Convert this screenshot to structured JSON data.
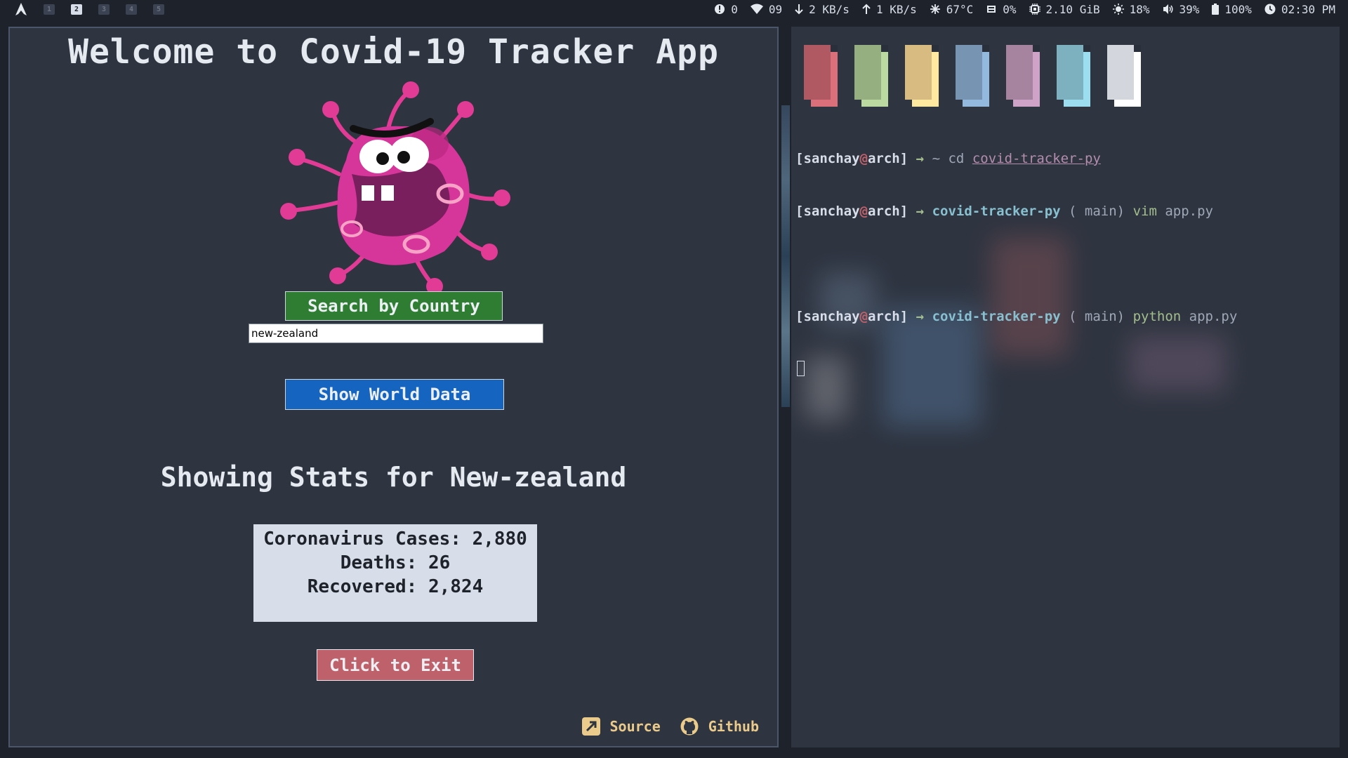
{
  "topbar": {
    "workspaces": [
      "1",
      "2",
      "3",
      "4",
      "5"
    ],
    "active_workspace": "2",
    "status": {
      "updates": "0",
      "wifi": "09",
      "download": "2 KB/s",
      "upload": "1 KB/s",
      "temperature": "67°C",
      "cpu": "0%",
      "memory": "2.10 GiB",
      "brightness": "18%",
      "volume": "39%",
      "battery": "100%",
      "clock": "02:30 PM"
    }
  },
  "app": {
    "title": "Welcome to Covid-19 Tracker App",
    "search_button_label": "Search by Country",
    "search_value": "new-zealand",
    "world_button_label": "Show World Data",
    "showing_heading": "Showing Stats for New-zealand",
    "stats": {
      "cases": "Coronavirus Cases: 2,880",
      "deaths": "Deaths: 26",
      "recovered": "Recovered: 2,824"
    },
    "exit_button_label": "Click to Exit",
    "links": {
      "source": "Source",
      "github": "Github"
    }
  },
  "terminal": {
    "swatch_colors": [
      "#bf616a",
      "#a3be8c",
      "#ebcb8b",
      "#81a1c1",
      "#b48ead",
      "#88c0d0",
      "#e5e9f0"
    ],
    "lines": [
      {
        "bracket_open": "[",
        "user": "sanchay",
        "at": "@",
        "host": "arch",
        "bracket_close": "]",
        "arrow": "→",
        "dir": "~",
        "cmd": "cd",
        "arg": "covid-tracker-py"
      },
      {
        "bracket_open": "[",
        "user": "sanchay",
        "at": "@",
        "host": "arch",
        "bracket_close": "]",
        "arrow": "→",
        "dir": "covid-tracker-py",
        "git": "( main)",
        "cmd": "vim",
        "arg": "app.py"
      },
      {
        "bracket_open": "[",
        "user": "sanchay",
        "at": "@",
        "host": "arch",
        "bracket_close": "]",
        "arrow": "→",
        "dir": "covid-tracker-py",
        "git": "( main)",
        "cmd": "python",
        "arg": "app.py"
      }
    ]
  }
}
